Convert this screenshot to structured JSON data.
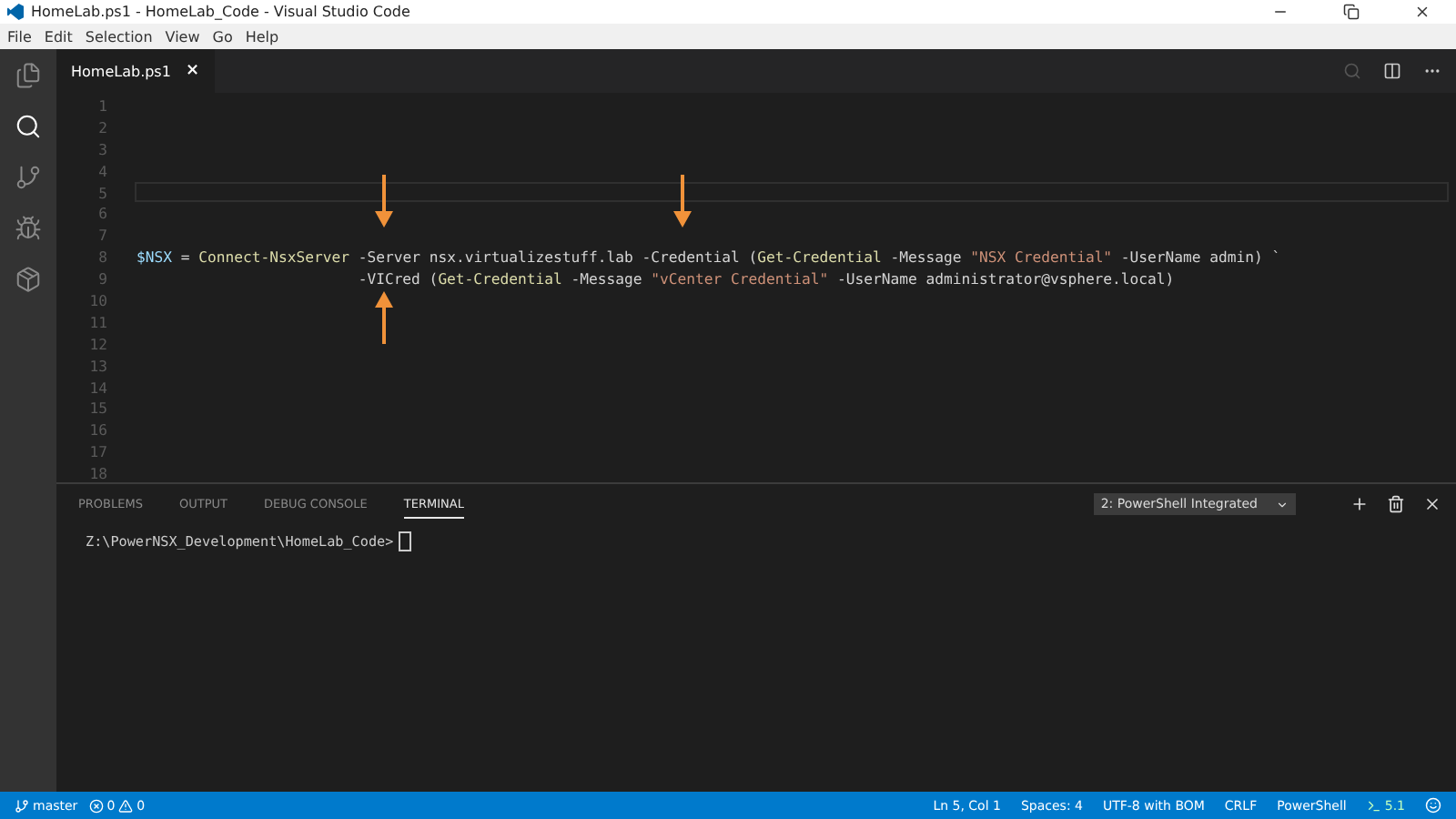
{
  "window": {
    "title": "HomeLab.ps1 - HomeLab_Code - Visual Studio Code"
  },
  "menu": [
    "File",
    "Edit",
    "Selection",
    "View",
    "Go",
    "Help"
  ],
  "activity_bar": [
    {
      "kind": "files",
      "selected": false
    },
    {
      "kind": "search",
      "selected": true
    },
    {
      "kind": "git",
      "selected": false
    },
    {
      "kind": "debug",
      "selected": false
    },
    {
      "kind": "extensions",
      "selected": false
    }
  ],
  "tabs": [
    {
      "label": "HomeLab.ps1",
      "close": "×",
      "selected": true
    }
  ],
  "editor": {
    "lines": [
      {
        "number": "1",
        "current": false
      },
      {
        "number": "2",
        "current": false
      },
      {
        "number": "3",
        "current": false
      },
      {
        "number": "4",
        "current": false
      },
      {
        "number": "5",
        "current": true
      },
      {
        "number": "6",
        "current": false
      },
      {
        "number": "7",
        "current": false
      },
      {
        "number": "8",
        "current": false,
        "tokens": [
          {
            "kind": "variable",
            "text": "$NSX"
          },
          {
            "kind": "plain",
            "text": " = "
          },
          {
            "kind": "command",
            "text": "Connect-NsxServer"
          },
          {
            "kind": "plain",
            "text": " -Server nsx.virtualizestuff.lab -Credential ("
          },
          {
            "kind": "command",
            "text": "Get-Credential"
          },
          {
            "kind": "plain",
            "text": " -Message "
          },
          {
            "kind": "string",
            "text": "\"NSX Credential\""
          },
          {
            "kind": "plain",
            "text": " -UserName admin) `"
          }
        ]
      },
      {
        "number": "9",
        "current": false,
        "tokens": [
          {
            "kind": "plain",
            "text": "                         -VICred ("
          },
          {
            "kind": "command",
            "text": "Get-Credential"
          },
          {
            "kind": "plain",
            "text": " -Message "
          },
          {
            "kind": "string",
            "text": "\"vCenter Credential\""
          },
          {
            "kind": "plain",
            "text": " -UserName administrator@vsphere.local)"
          }
        ]
      },
      {
        "number": "10",
        "current": false
      },
      {
        "number": "11",
        "current": false
      },
      {
        "number": "12",
        "current": false
      },
      {
        "number": "13",
        "current": false
      },
      {
        "number": "14",
        "current": false
      },
      {
        "number": "15",
        "current": false
      },
      {
        "number": "16",
        "current": false
      },
      {
        "number": "17",
        "current": false
      },
      {
        "number": "18",
        "current": false
      }
    ]
  },
  "panel": {
    "tabs": [
      {
        "label": "PROBLEMS",
        "selected": false
      },
      {
        "label": "OUTPUT",
        "selected": false
      },
      {
        "label": "DEBUG CONSOLE",
        "selected": false
      },
      {
        "label": "TERMINAL",
        "selected": true
      }
    ],
    "terminal_select": "2: PowerShell Integrated",
    "prompt": "Z:\\PowerNSX_Development\\HomeLab_Code>"
  },
  "status_bar": {
    "branch": "master",
    "errors": "0",
    "warnings": "0",
    "items": [
      "Ln 5, Col 1",
      "Spaces: 4",
      "UTF-8 with BOM",
      "CRLF",
      "PowerShell"
    ],
    "version": "5.1"
  }
}
